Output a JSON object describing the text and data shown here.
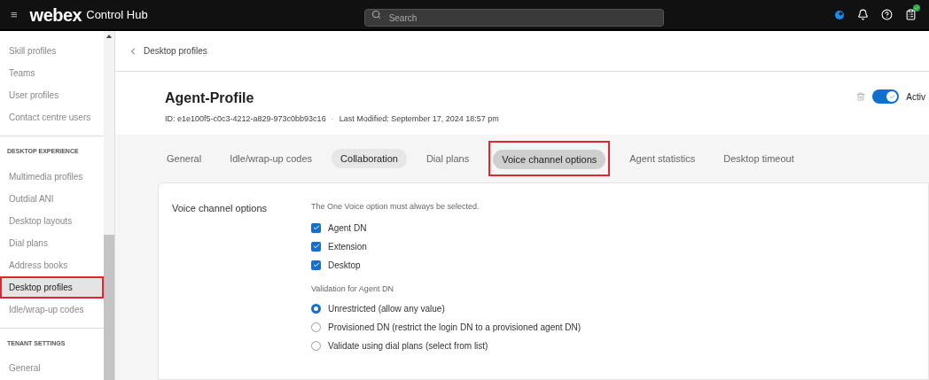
{
  "topbar": {
    "menu_glyph": "≡",
    "brand": "webex",
    "product": "Control Hub",
    "search": {
      "placeholder": "Search"
    }
  },
  "sidebar": {
    "groups": [
      {
        "items": [
          {
            "label": "Skill profiles",
            "selected": false,
            "annotated": false
          },
          {
            "label": "Teams",
            "selected": false,
            "annotated": false
          },
          {
            "label": "User profiles",
            "selected": false,
            "annotated": false
          },
          {
            "label": "Contact centre users",
            "selected": false,
            "annotated": false
          }
        ]
      },
      {
        "heading": "DESKTOP EXPERIENCE",
        "items": [
          {
            "label": "Multimedia profiles",
            "selected": false,
            "annotated": false
          },
          {
            "label": "Outdial ANI",
            "selected": false,
            "annotated": false
          },
          {
            "label": "Desktop layouts",
            "selected": false,
            "annotated": false
          },
          {
            "label": "Dial plans",
            "selected": false,
            "annotated": false
          },
          {
            "label": "Address books",
            "selected": false,
            "annotated": false
          },
          {
            "label": "Desktop profiles",
            "selected": true,
            "annotated": true
          },
          {
            "label": "Idle/wrap-up codes",
            "selected": false,
            "annotated": false
          }
        ]
      },
      {
        "heading": "TENANT SETTINGS",
        "items": [
          {
            "label": "General",
            "selected": false,
            "annotated": false
          }
        ]
      }
    ]
  },
  "breadcrumb": {
    "label": "Desktop profiles"
  },
  "profile": {
    "title": "Agent-Profile",
    "id": "ID: e1e100f5-c0c3-4212-a829-973c0bb93c16",
    "separator": "·",
    "modified": "Last Modified: September 17, 2024 18:57 pm",
    "active_toggle": {
      "on": true,
      "label": "Activ"
    }
  },
  "tabs": [
    {
      "label": "General",
      "selected": false,
      "hovered": false,
      "annotated": false
    },
    {
      "label": "Idle/wrap-up codes",
      "selected": false,
      "hovered": false,
      "annotated": false
    },
    {
      "label": "Collaboration",
      "selected": false,
      "hovered": true,
      "annotated": false
    },
    {
      "label": "Dial plans",
      "selected": false,
      "hovered": false,
      "annotated": false
    },
    {
      "label": "Voice channel options",
      "selected": true,
      "hovered": false,
      "annotated": true
    },
    {
      "label": "Agent statistics",
      "selected": false,
      "hovered": false,
      "annotated": false
    },
    {
      "label": "Desktop timeout",
      "selected": false,
      "hovered": false,
      "annotated": false
    }
  ],
  "voice_channel": {
    "label": "Voice channel options",
    "note": "The One Voice option must always be selected.",
    "options": [
      {
        "label": "Agent DN",
        "checked": true
      },
      {
        "label": "Extension",
        "checked": true
      },
      {
        "label": "Desktop",
        "checked": true
      }
    ],
    "validation_heading": "Validation for Agent DN",
    "validation": [
      {
        "label": "Unrestricted (allow any value)",
        "selected": true
      },
      {
        "label": "Provisioned DN (restrict the login DN to a provisioned agent DN)",
        "selected": false
      },
      {
        "label": "Validate using dial plans (select from list)",
        "selected": false
      }
    ]
  }
}
